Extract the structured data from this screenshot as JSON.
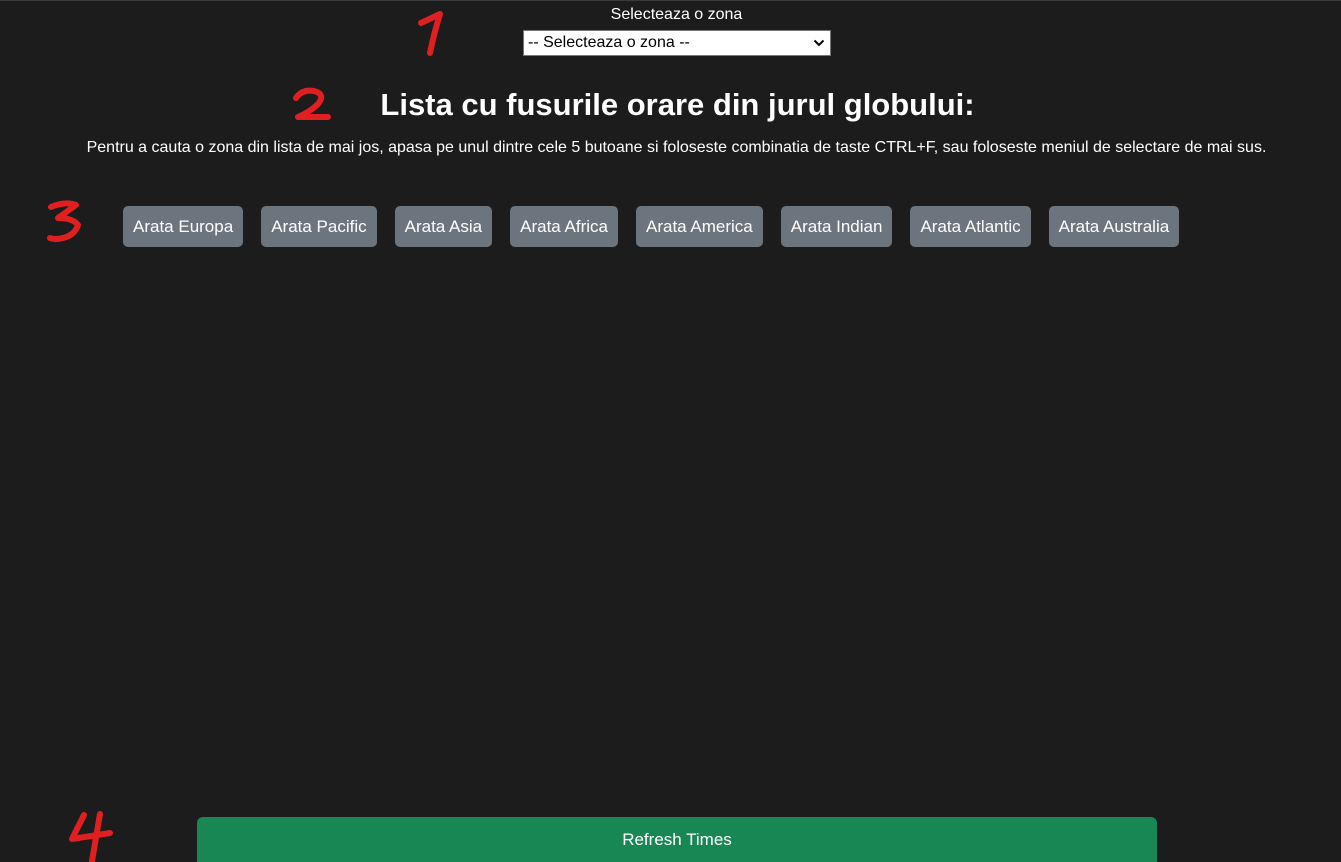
{
  "zone_select": {
    "label": "Selecteaza o zona",
    "selected": "-- Selecteaza o zona --"
  },
  "heading": {
    "title": "Lista cu fusurile orare din jurul globului:",
    "description": "Pentru a cauta o zona din lista de mai jos, apasa pe unul dintre cele 5 butoane si foloseste combinatia de taste CTRL+F, sau foloseste meniul de selectare de mai sus."
  },
  "region_buttons": [
    "Arata Europa",
    "Arata Pacific",
    "Arata Asia",
    "Arata Africa",
    "Arata America",
    "Arata Indian",
    "Arata Atlantic",
    "Arata Australia"
  ],
  "refresh": {
    "label": "Refresh Times"
  },
  "annotation_markers": [
    "1",
    "2",
    "3",
    "4"
  ],
  "colors": {
    "background": "#1c1c1c",
    "region_button": "#6c757d",
    "refresh_button": "#198754",
    "marker": "#e02020"
  }
}
